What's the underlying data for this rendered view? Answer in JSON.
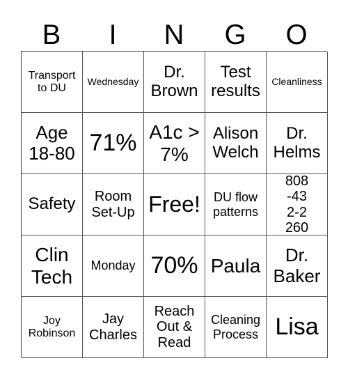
{
  "header": [
    "B",
    "I",
    "N",
    "G",
    "O"
  ],
  "cells": [
    [
      "Transport to DU",
      "Wednesday",
      "Dr. Brown",
      "Test results",
      "Cleanliness"
    ],
    [
      "Age 18-80",
      "71%",
      "A1c > 7%",
      "Alison Welch",
      "Dr. Helms"
    ],
    [
      "Safety",
      "Room Set-Up",
      "Free!",
      "DU flow patterns",
      "808-432-2260"
    ],
    [
      "Clin Tech",
      "Monday",
      "70%",
      "Paula",
      "Dr. Baker"
    ],
    [
      "Joy Robinson",
      "Jay Charles",
      "Reach Out & Read",
      "Cleaning Process",
      "Lisa"
    ]
  ]
}
